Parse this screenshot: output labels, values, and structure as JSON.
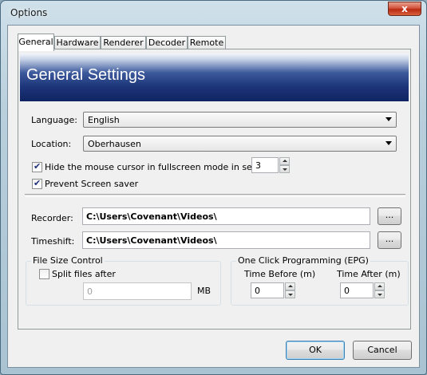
{
  "window": {
    "title": "Options",
    "close_glyph": "x"
  },
  "tabs": [
    "General",
    "Hardware",
    "Renderer",
    "Decoder",
    "Remote"
  ],
  "banner": {
    "title": "General Settings"
  },
  "language": {
    "label": "Language:",
    "value": "English"
  },
  "location": {
    "label": "Location:",
    "value": "Oberhausen"
  },
  "hide_cursor": {
    "label": "Hide the mouse cursor in fullscreen mode in secs:",
    "checked": true,
    "value": "3"
  },
  "prevent_screensaver": {
    "label": "Prevent Screen saver",
    "checked": true
  },
  "recorder": {
    "label": "Recorder:",
    "value": "C:\\Users\\Covenant\\Videos\\",
    "browse": "..."
  },
  "timeshift": {
    "label": "Timeshift:",
    "value": "C:\\Users\\Covenant\\Videos\\",
    "browse": "..."
  },
  "file_size": {
    "group_label": "File Size Control",
    "split_label": "Split files after",
    "split_checked": false,
    "value": "0",
    "unit": "MB"
  },
  "epg": {
    "group_label": "One Click Programming (EPG)",
    "before_label": "Time Before (m)",
    "before_value": "0",
    "after_label": "Time After (m)",
    "after_value": "0"
  },
  "buttons": {
    "ok": "OK",
    "cancel": "Cancel"
  },
  "icons": {
    "close": "close-icon",
    "dropdown": "chevron-down-icon",
    "spin_up": "spin-up-icon",
    "spin_down": "spin-down-icon",
    "checkmark": "checkmark-icon"
  }
}
